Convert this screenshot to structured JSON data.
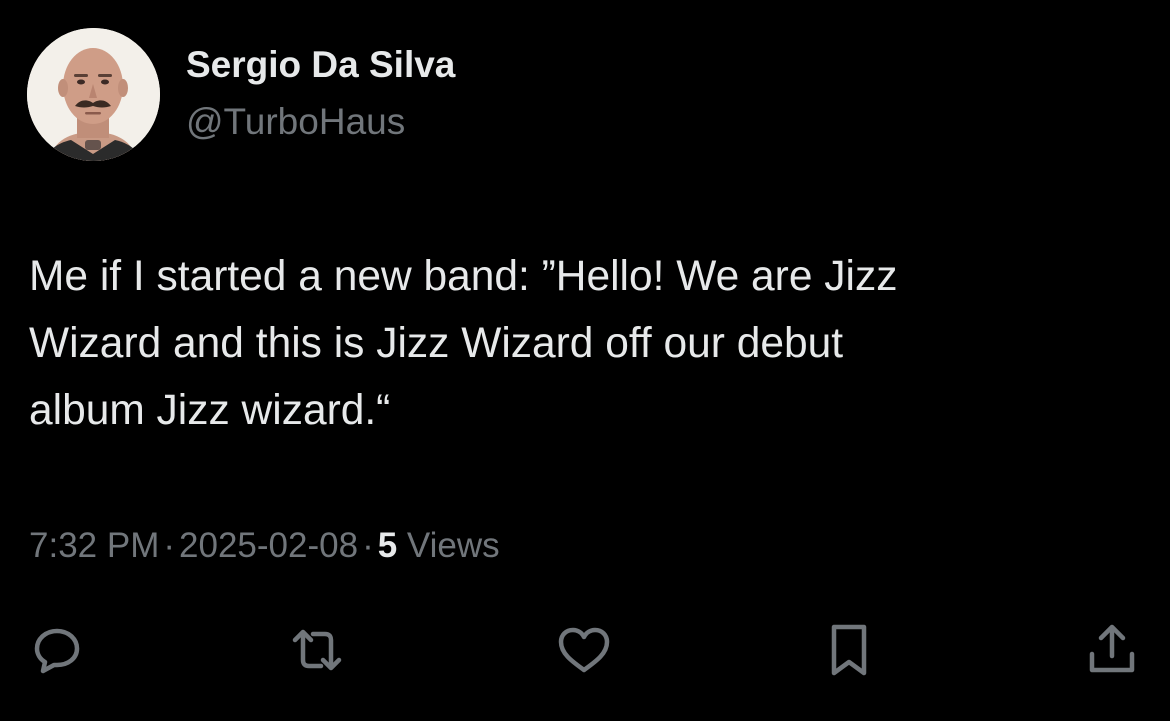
{
  "author": {
    "display_name": "Sergio Da Silva",
    "handle": "@TurboHaus",
    "avatar_icon": "profile-photo"
  },
  "tweet": {
    "text_lines": [
      "Me if I started a new band: ”Hello! We are Jizz",
      "Wizard and this is Jizz Wizard off our debut",
      "album Jizz wizard.“"
    ]
  },
  "meta": {
    "time": "7:32 PM",
    "separator": "·",
    "date": "2025-02-08",
    "views_count": "5",
    "views_label": "Views"
  },
  "actions": [
    {
      "name": "reply",
      "icon": "speech-bubble-icon"
    },
    {
      "name": "repost",
      "icon": "repost-arrows-icon"
    },
    {
      "name": "like",
      "icon": "heart-icon"
    },
    {
      "name": "bookmark",
      "icon": "bookmark-icon"
    },
    {
      "name": "share",
      "icon": "share-upload-icon"
    }
  ],
  "colors": {
    "background": "#000000",
    "primary_text": "#e7e9ea",
    "secondary_text": "#71767b"
  }
}
